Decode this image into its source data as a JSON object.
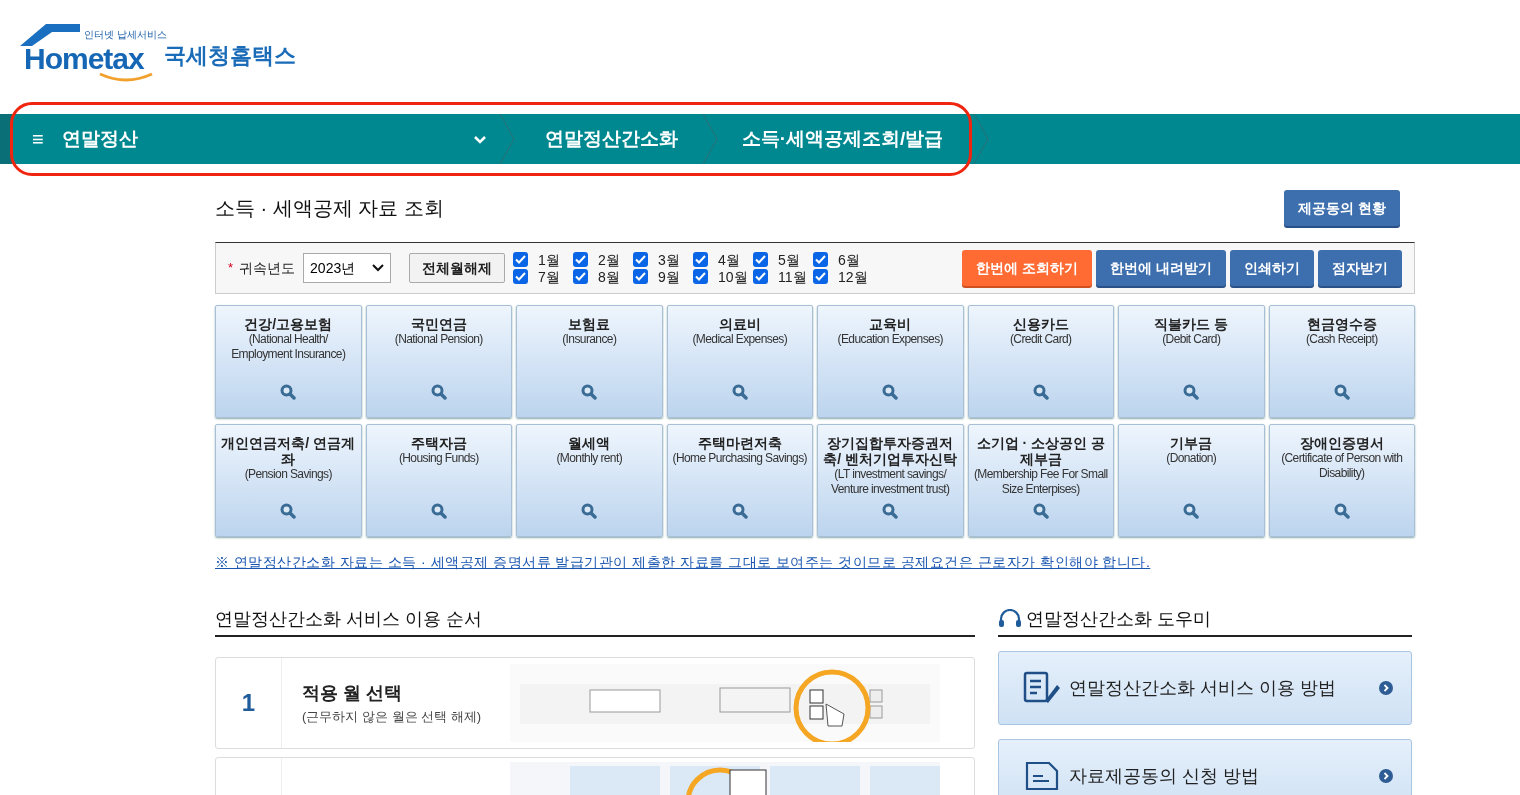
{
  "logo": {
    "tagline": "인터넷 납세서비스",
    "brand": "Hometax",
    "name": "국세청홈택스"
  },
  "nav": {
    "menu_icon": "≡",
    "items": [
      {
        "label": "연말정산",
        "dropdown": true
      },
      {
        "label": "연말정산간소화"
      },
      {
        "label": "소득·세액공제조회/발급"
      }
    ],
    "highlighted": true
  },
  "title": "소득 · 세액공제 자료 조회",
  "consent_button": "제공동의 현황",
  "filter": {
    "required_mark": "*",
    "year_label": "귀속년도",
    "year_value": "2023년",
    "clear_button": "전체월해제",
    "months": [
      {
        "label": "1월",
        "checked": true
      },
      {
        "label": "2월",
        "checked": true
      },
      {
        "label": "3월",
        "checked": true
      },
      {
        "label": "4월",
        "checked": true
      },
      {
        "label": "5월",
        "checked": true
      },
      {
        "label": "6월",
        "checked": true
      },
      {
        "label": "7월",
        "checked": true
      },
      {
        "label": "8월",
        "checked": true
      },
      {
        "label": "9월",
        "checked": true
      },
      {
        "label": "10월",
        "checked": true
      },
      {
        "label": "11월",
        "checked": true
      },
      {
        "label": "12월",
        "checked": true
      }
    ],
    "actions": [
      {
        "label": "한번에 조회하기",
        "kind": "primary"
      },
      {
        "label": "한번에 내려받기",
        "kind": "secondary"
      },
      {
        "label": "인쇄하기",
        "kind": "secondary"
      },
      {
        "label": "점자받기",
        "kind": "secondary"
      }
    ]
  },
  "categories": [
    {
      "title": "건강/고용보험",
      "subtitle": "(National Health/ Employment Insurance)"
    },
    {
      "title": "국민연금",
      "subtitle": "(National Pension)"
    },
    {
      "title": "보험료",
      "subtitle": "(Insurance)"
    },
    {
      "title": "의료비",
      "subtitle": "(Medical Expenses)"
    },
    {
      "title": "교육비",
      "subtitle": "(Education Expenses)"
    },
    {
      "title": "신용카드",
      "subtitle": "(Credit Card)"
    },
    {
      "title": "직불카드 등",
      "subtitle": "(Debit Card)"
    },
    {
      "title": "현금영수증",
      "subtitle": "(Cash Receipt)"
    },
    {
      "title": "개인연금저축/ 연금계좌",
      "subtitle": "(Pension Savings)"
    },
    {
      "title": "주택자금",
      "subtitle": "(Housing Funds)"
    },
    {
      "title": "월세액",
      "subtitle": "(Monthly rent)"
    },
    {
      "title": "주택마련저축",
      "subtitle": "(Home Purchasing Savings)"
    },
    {
      "title": "장기집합투자증권저축/ 벤처기업투자신탁",
      "subtitle": "(LT investment savings/ Venture investment trust)"
    },
    {
      "title": "소기업 · 소상공인 공제부금",
      "subtitle": "(Membership Fee For Small Size Enterpises)"
    },
    {
      "title": "기부금",
      "subtitle": "(Donation)"
    },
    {
      "title": "장애인증명서",
      "subtitle": "(Certificate of Person with Disability)"
    }
  ],
  "notice": "※ 연말정산간소화 자료는 소득 · 세액공제 증명서류 발급기관이 제출한 자료를 그대로 보여주는 것이므로 공제요건은 근로자가 확인해야 합니다.",
  "steps": {
    "heading": "연말정산간소화 서비스 이용 순서",
    "items": [
      {
        "number": "1",
        "title": "적용 월 선택",
        "description": "(근무하지 않은 월은 선택 해제)",
        "image": {
          "kind": "picture"
        }
      },
      {
        "image": {
          "kind": "picture"
        }
      }
    ]
  },
  "helper": {
    "heading": "연말정산간소화 도우미",
    "links": [
      {
        "label": "연말정산간소화 서비스 이용 방법",
        "kind": "guide"
      },
      {
        "label": "자료제공동의 신청 방법",
        "kind": "document"
      }
    ]
  }
}
